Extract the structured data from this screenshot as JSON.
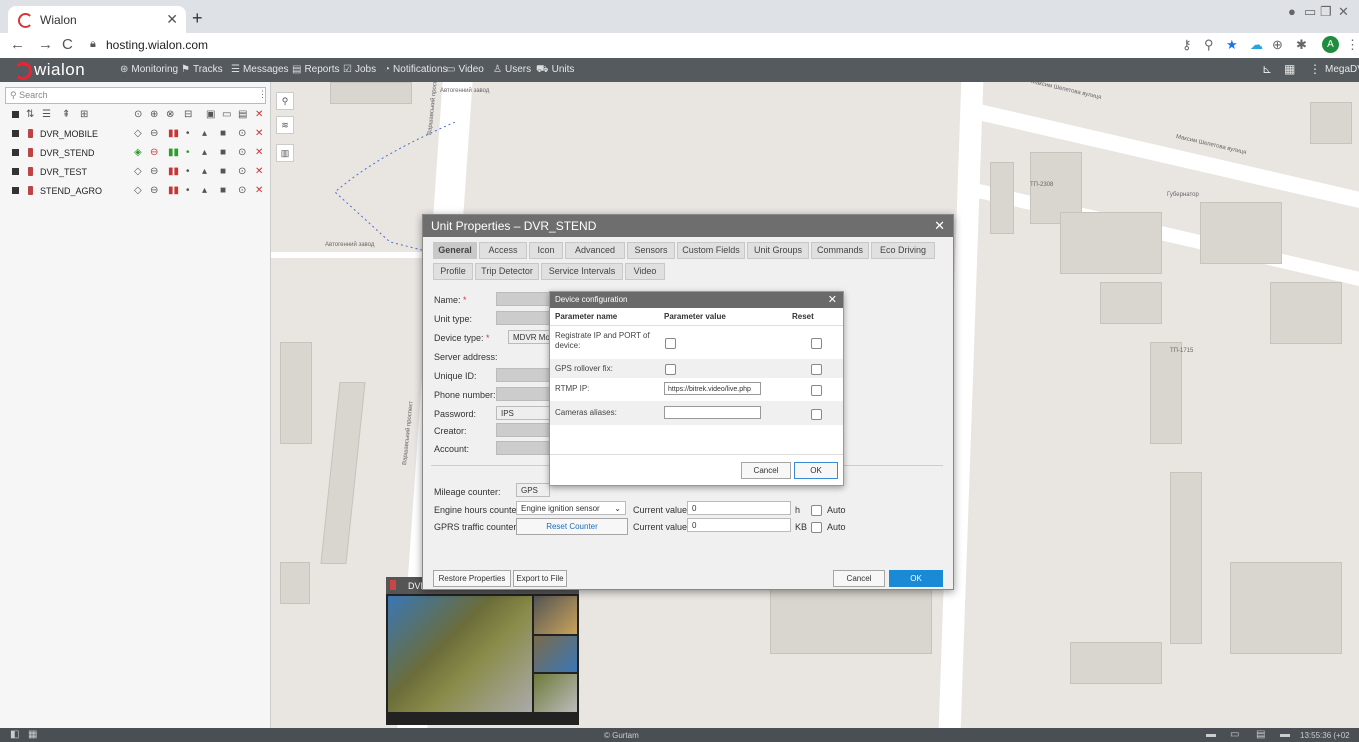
{
  "browser": {
    "tab_title": "Wialon",
    "url": "hosting.wialon.com",
    "avatar_letter": "A"
  },
  "topbar": {
    "logo": "wialon",
    "menu": [
      {
        "label": "Monitoring",
        "icon": "globe-icon"
      },
      {
        "label": "Tracks",
        "icon": "tracks-icon"
      },
      {
        "label": "Messages",
        "icon": "messages-icon"
      },
      {
        "label": "Reports",
        "icon": "reports-icon"
      },
      {
        "label": "Jobs",
        "icon": "jobs-icon"
      },
      {
        "label": "Notifications",
        "icon": "bell-icon"
      },
      {
        "label": "Video",
        "icon": "video-icon"
      },
      {
        "label": "Users",
        "icon": "users-icon"
      },
      {
        "label": "Units",
        "icon": "units-icon"
      }
    ],
    "user": "MegaDVR"
  },
  "sidebar": {
    "search_placeholder": "Search",
    "units": [
      {
        "name": "DVR_MOBILE"
      },
      {
        "name": "DVR_STEND"
      },
      {
        "name": "DVR_TEST"
      },
      {
        "name": "STEND_AGRO"
      }
    ]
  },
  "map": {
    "labels": [
      "Автогенний завод",
      "Автогенний завод",
      "Варшавський проспект",
      "Варшавський проспект",
      "Максим Шепетова вулиця",
      "Максим Шепетова вулиця",
      "Губернатор",
      "ТП-2308",
      "ТП-1715"
    ]
  },
  "unit_props": {
    "title": "Unit Properties – DVR_STEND",
    "tabs_row1": [
      "General",
      "Access",
      "Icon",
      "Advanced",
      "Sensors",
      "Custom Fields",
      "Unit Groups",
      "Commands",
      "Eco Driving"
    ],
    "tabs_row2": [
      "Profile",
      "Trip Detector",
      "Service Intervals",
      "Video"
    ],
    "fields": {
      "name": "Name:",
      "unit_type": "Unit type:",
      "device_type": "Device type:",
      "device_type_value": "MDVR Module",
      "server_address": "Server address:",
      "unique_id": "Unique ID:",
      "phone": "Phone number:",
      "password": "Password:",
      "password_value": "IPS",
      "creator": "Creator:",
      "account": "Account:"
    },
    "counters": {
      "mileage": "Mileage counter:",
      "mileage_value": "GPS",
      "engine_hours": "Engine hours counter:",
      "engine_hours_value": "Engine ignition sensor",
      "gprs": "GPRS traffic counter:",
      "reset_counter": "Reset Counter",
      "current_value_label": "Current value:",
      "engine_current": "0",
      "gprs_current": "0",
      "h_unit": "h",
      "kb_unit": "KB",
      "auto": "Auto"
    },
    "buttons": {
      "restore": "Restore Properties",
      "export": "Export to File",
      "cancel": "Cancel",
      "ok": "OK"
    }
  },
  "device_config": {
    "title": "Device configuration",
    "col_name": "Parameter name",
    "col_value": "Parameter value",
    "col_reset": "Reset",
    "rows": [
      {
        "name": "Registrate IP and PORT of device:"
      },
      {
        "name": "GPS rollover fix:"
      },
      {
        "name": "RTMP IP:",
        "value": "https://bitrek.video/live.php"
      },
      {
        "name": "Cameras aliases:",
        "value": ""
      }
    ],
    "cancel": "Cancel",
    "ok": "OK"
  },
  "video_panel": {
    "title": "DVR"
  },
  "statusbar": {
    "copyright": "© Gurtam",
    "clock": "13:55:36 (+02"
  }
}
